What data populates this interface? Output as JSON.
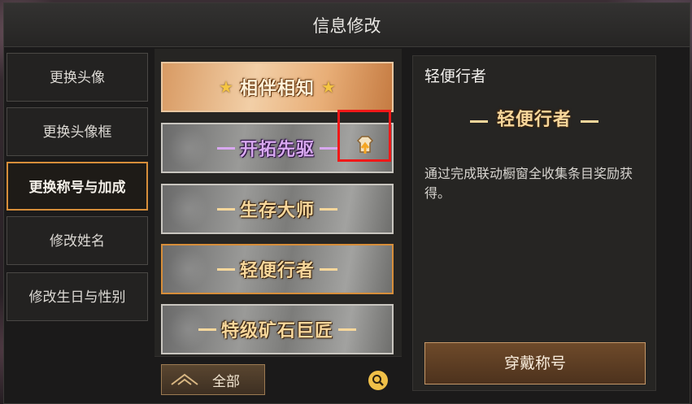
{
  "window": {
    "title": "信息修改"
  },
  "sidebar": {
    "items": [
      {
        "label": "更换头像",
        "active": false
      },
      {
        "label": "更换头像框",
        "active": false
      },
      {
        "label": "更换称号与加成",
        "active": true
      },
      {
        "label": "修改姓名",
        "active": false
      },
      {
        "label": "修改生日与性别",
        "active": false
      }
    ]
  },
  "titles": [
    {
      "text": "相伴相知",
      "style": "gold-with-stars"
    },
    {
      "text": "开拓先驱",
      "style": "silver-purple",
      "badge": "upgrade-icon"
    },
    {
      "text": "生存大师",
      "style": "silver"
    },
    {
      "text": "轻便行者",
      "style": "silver-selected"
    },
    {
      "text": "特级矿石巨匠",
      "style": "silver"
    }
  ],
  "bottom": {
    "filter_label": "全部",
    "search_icon": "search-icon"
  },
  "detail": {
    "name": "轻便行者",
    "banner_text": "轻便行者",
    "description": "通过完成联动橱窗全收集条目奖励获得。",
    "button_label": "穿戴称号"
  },
  "colors": {
    "accent": "#d78e3a",
    "highlight": "#f01818",
    "gold_text": "#f7d79b"
  }
}
